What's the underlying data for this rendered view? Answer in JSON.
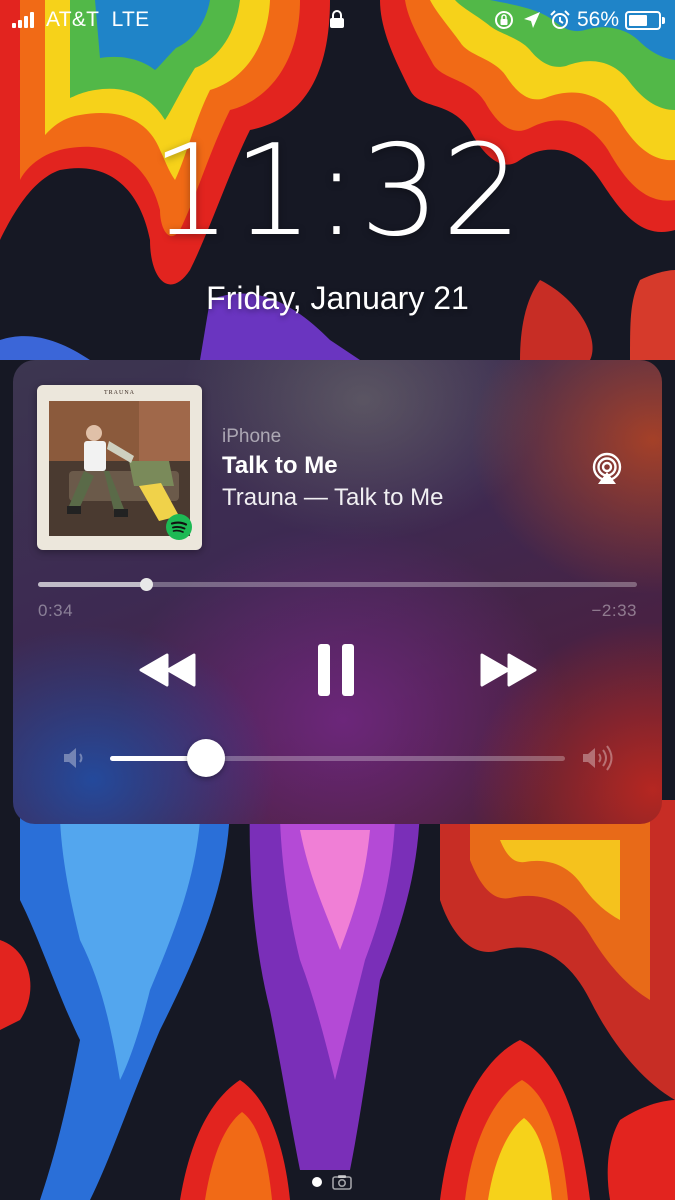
{
  "status_bar": {
    "carrier": "AT&T",
    "network": "LTE",
    "battery_percent": "56%",
    "icons": [
      "signal-bars-icon",
      "lock-icon",
      "orientation-lock-icon",
      "location-arrow-icon",
      "alarm-icon",
      "battery-icon"
    ]
  },
  "lock_screen": {
    "time": "11:32",
    "date": "Friday, January 21"
  },
  "now_playing": {
    "source_device": "iPhone",
    "title": "Talk to Me",
    "subtitle": "Trauna — Talk to Me",
    "album_art_label": "TRAUNA",
    "album_art_badge": "spotify-icon",
    "elapsed": "0:34",
    "remaining": "−2:33",
    "progress_fraction": 0.18,
    "volume_fraction": 0.21,
    "controls": [
      "rewind-icon",
      "pause-icon",
      "fast-forward-icon"
    ],
    "airplay_icon": "airplay-icon"
  },
  "page_indicator": {
    "pages": 1,
    "active": 0,
    "extra_icon": "camera-icon"
  },
  "colors": {
    "spotify_green": "#1DB954",
    "widget_tint": "#3d2a52"
  }
}
